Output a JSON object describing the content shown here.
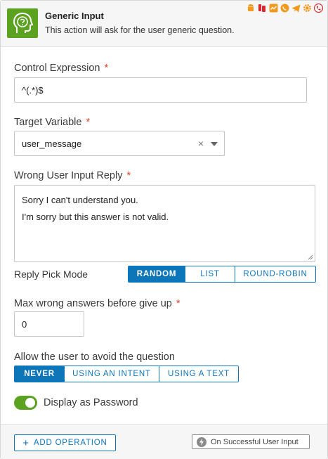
{
  "header": {
    "title": "Generic Input",
    "description": "This action will ask for the user generic question.",
    "icon": "head-question-icon",
    "accent": "#5aa220",
    "channel_icons": [
      "android-icon",
      "sms-icon",
      "messenger-icon",
      "whatsapp-icon",
      "telegram-icon",
      "cog-icon",
      "phone-icon"
    ]
  },
  "control_expression": {
    "label": "Control Expression",
    "required_mark": "*",
    "value": "^(.*)$"
  },
  "target_variable": {
    "label": "Target Variable",
    "required_mark": "*",
    "value": "user_message",
    "clear_glyph": "×"
  },
  "wrong_input_reply": {
    "label": "Wrong User Input Reply",
    "required_mark": "*",
    "lines": [
      "Sorry I can't understand you.",
      "I'm sorry but this answer is not valid."
    ]
  },
  "reply_pick_mode": {
    "label": "Reply Pick Mode",
    "options": [
      "RANDOM",
      "LIST",
      "ROUND-ROBIN"
    ],
    "selected": "RANDOM"
  },
  "max_wrong_answers": {
    "label": "Max wrong answers before give up",
    "required_mark": "*",
    "value": "0"
  },
  "avoid_question": {
    "label": "Allow the user to avoid the question",
    "options": [
      "NEVER",
      "USING AN INTENT",
      "USING A TEXT"
    ],
    "selected": "NEVER"
  },
  "display_password": {
    "label": "Display as Password",
    "enabled": true
  },
  "footer": {
    "add_operation_label": "ADD OPERATION",
    "add_glyph": "+",
    "success_label": "On Successful User Input"
  },
  "colors": {
    "primary": "#0d76b8",
    "green": "#5aa220",
    "required": "#e0442c"
  }
}
